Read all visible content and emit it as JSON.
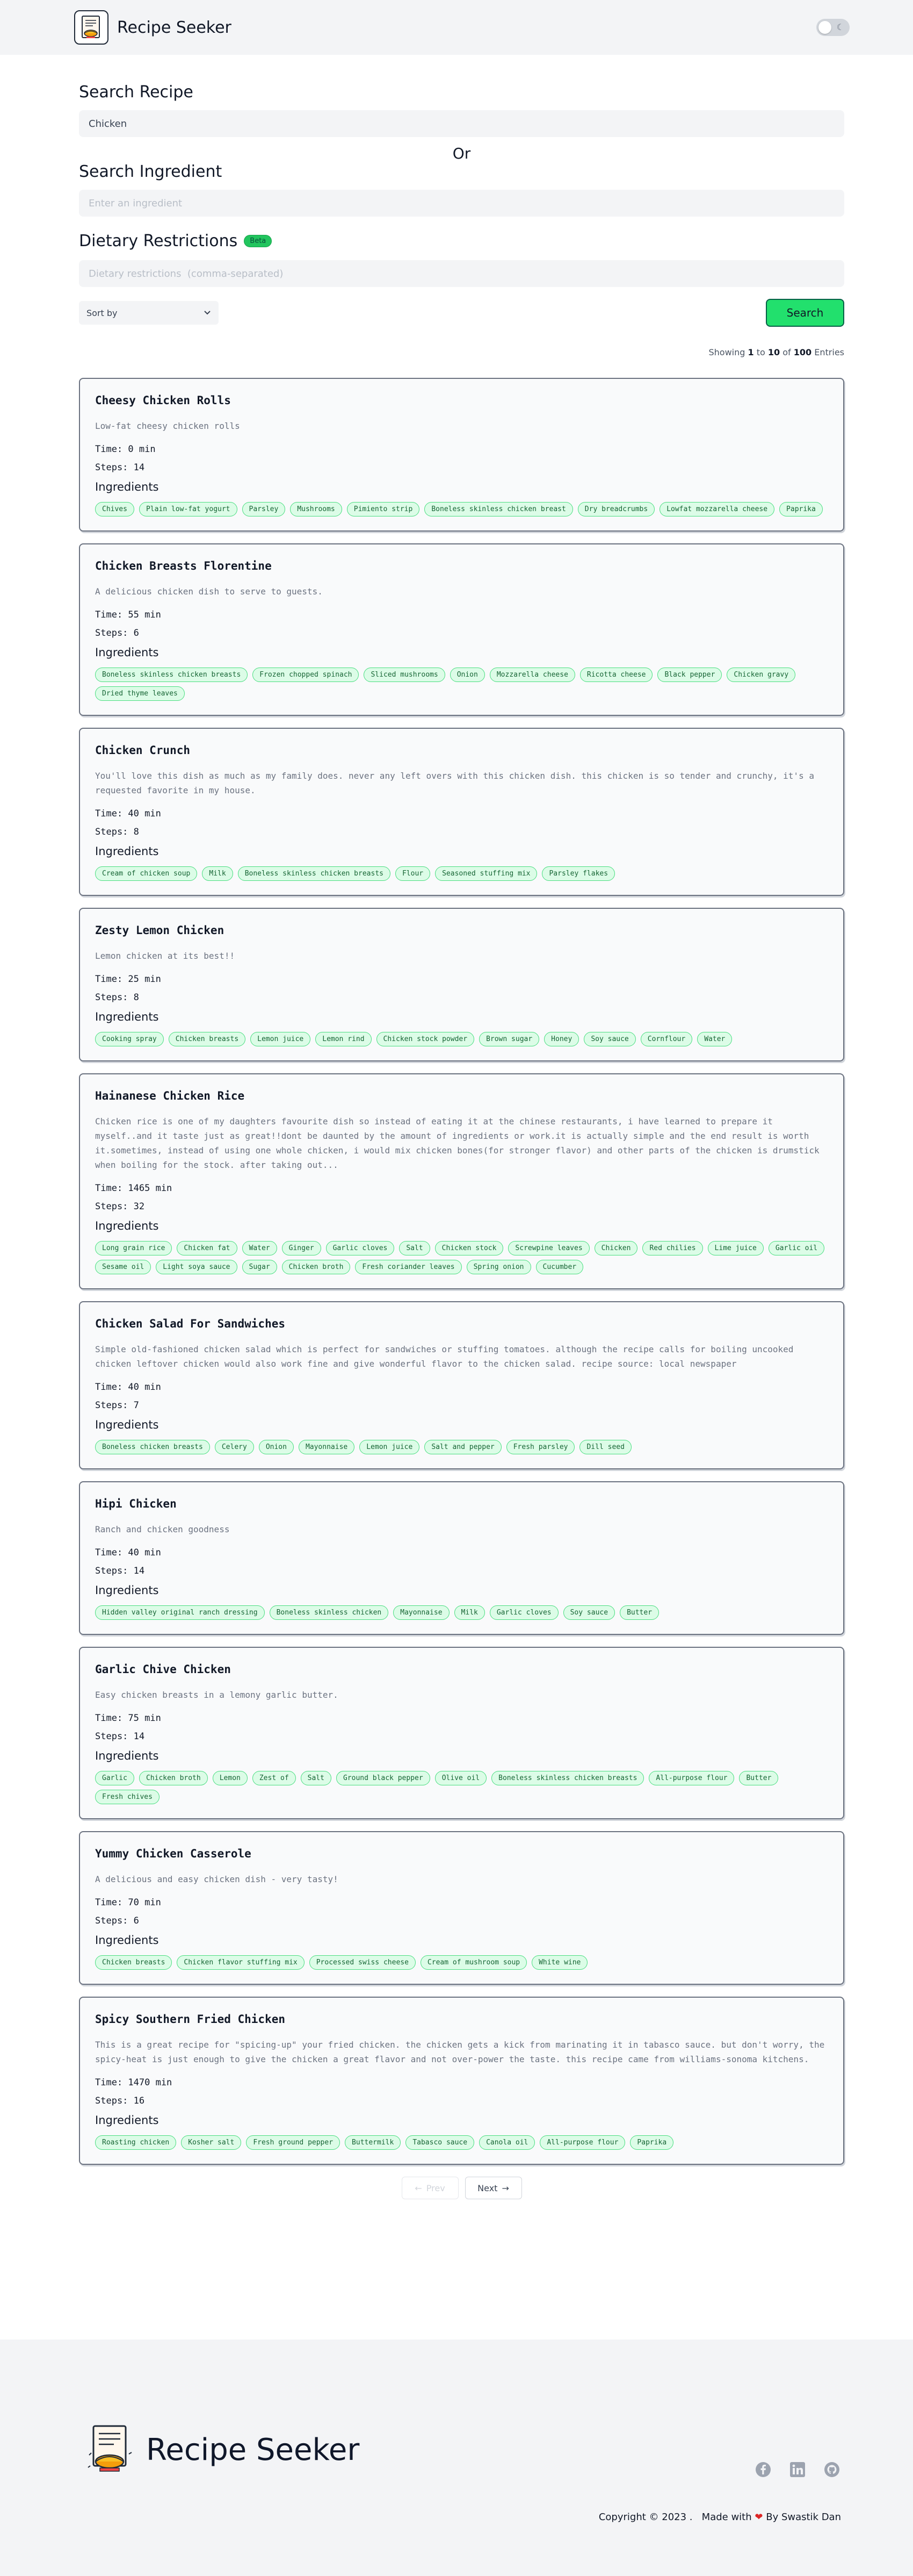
{
  "header": {
    "title": "Recipe Seeker"
  },
  "search": {
    "recipe_label": "Search Recipe",
    "recipe_value": "Chicken",
    "or_label": "Or",
    "ingredient_label": "Search Ingredient",
    "ingredient_placeholder": "Enter an ingredient",
    "dietary_label": "Dietary Restrictions",
    "beta_badge": "Beta",
    "dietary_placeholder": "Dietary restrictions  (comma-separated)",
    "sort_label": "Sort by",
    "search_button": "Search"
  },
  "results": {
    "showing_prefix": "Showing",
    "from": "1",
    "to_word": "to",
    "to": "10",
    "of_word": "of",
    "total": "100",
    "suffix": "Entries"
  },
  "recipes": [
    {
      "title": "Cheesy Chicken Rolls",
      "description": "Low-fat cheesy chicken rolls",
      "time": "Time: 0 min",
      "steps": "Steps: 14",
      "ingredients_label": "Ingredients",
      "ingredients": [
        "Chives",
        "Plain low-fat yogurt",
        "Parsley",
        "Mushrooms",
        "Pimiento strip",
        "Boneless skinless chicken breast",
        "Dry breadcrumbs",
        "Lowfat mozzarella cheese",
        "Paprika"
      ]
    },
    {
      "title": "Chicken Breasts Florentine",
      "description": "A delicious chicken dish to serve to guests.",
      "time": "Time: 55 min",
      "steps": "Steps: 6",
      "ingredients_label": "Ingredients",
      "ingredients": [
        "Boneless skinless chicken breasts",
        "Frozen chopped spinach",
        "Sliced mushrooms",
        "Onion",
        "Mozzarella cheese",
        "Ricotta cheese",
        "Black pepper",
        "Chicken gravy",
        "Dried thyme leaves"
      ]
    },
    {
      "title": "Chicken Crunch",
      "description": "You'll love this dish as much as my family does. never any left overs with this chicken dish. this chicken is so tender and crunchy, it's a requested favorite in my house.",
      "time": "Time: 40 min",
      "steps": "Steps: 8",
      "ingredients_label": "Ingredients",
      "ingredients": [
        "Cream of chicken soup",
        "Milk",
        "Boneless skinless chicken breasts",
        "Flour",
        "Seasoned stuffing mix",
        "Parsley flakes"
      ]
    },
    {
      "title": "Zesty Lemon Chicken",
      "description": "Lemon chicken at its best!!",
      "time": "Time: 25 min",
      "steps": "Steps: 8",
      "ingredients_label": "Ingredients",
      "ingredients": [
        "Cooking spray",
        "Chicken breasts",
        "Lemon juice",
        "Lemon rind",
        "Chicken stock powder",
        "Brown sugar",
        "Honey",
        "Soy sauce",
        "Cornflour",
        "Water"
      ]
    },
    {
      "title": "Hainanese Chicken Rice",
      "description": "Chicken rice is one of my daughters favourite dish so instead of eating it at the chinese restaurants, i have learned to prepare it myself..and it taste just as great!!dont be daunted by the amount of ingredients or work.it is actually simple and the end result is worth it.sometimes, instead of using one whole chicken, i would mix chicken bones(for stronger flavor) and other parts of the chicken is drumstick when boiling for the stock. after taking out...",
      "time": "Time: 1465 min",
      "steps": "Steps: 32",
      "ingredients_label": "Ingredients",
      "ingredients": [
        "Long grain rice",
        "Chicken fat",
        "Water",
        "Ginger",
        "Garlic cloves",
        "Salt",
        "Chicken stock",
        "Screwpine leaves",
        "Chicken",
        "Red chilies",
        "Lime juice",
        "Garlic oil",
        "Sesame oil",
        "Light soya sauce",
        "Sugar",
        "Chicken broth",
        "Fresh coriander leaves",
        "Spring onion",
        "Cucumber"
      ]
    },
    {
      "title": "Chicken Salad For Sandwiches",
      "description": "Simple old-fashioned chicken salad which is perfect for sandwiches or stuffing tomatoes. although the recipe calls for boiling uncooked chicken leftover chicken would also work fine and give wonderful flavor to the chicken salad. recipe source: local newspaper",
      "time": "Time: 40 min",
      "steps": "Steps: 7",
      "ingredients_label": "Ingredients",
      "ingredients": [
        "Boneless chicken breasts",
        "Celery",
        "Onion",
        "Mayonnaise",
        "Lemon juice",
        "Salt and pepper",
        "Fresh parsley",
        "Dill seed"
      ]
    },
    {
      "title": "Hipi Chicken",
      "description": "Ranch and chicken goodness",
      "time": "Time: 40 min",
      "steps": "Steps: 14",
      "ingredients_label": "Ingredients",
      "ingredients": [
        "Hidden valley original ranch dressing",
        "Boneless skinless chicken",
        "Mayonnaise",
        "Milk",
        "Garlic cloves",
        "Soy sauce",
        "Butter"
      ]
    },
    {
      "title": "Garlic Chive Chicken",
      "description": "Easy chicken breasts in a lemony garlic butter.",
      "time": "Time: 75 min",
      "steps": "Steps: 14",
      "ingredients_label": "Ingredients",
      "ingredients": [
        "Garlic",
        "Chicken broth",
        "Lemon",
        "Zest of",
        "Salt",
        "Ground black pepper",
        "Olive oil",
        "Boneless skinless chicken breasts",
        "All-purpose flour",
        "Butter",
        "Fresh chives"
      ]
    },
    {
      "title": "Yummy Chicken Casserole",
      "description": "A delicious and easy chicken dish - very tasty!",
      "time": "Time: 70 min",
      "steps": "Steps: 6",
      "ingredients_label": "Ingredients",
      "ingredients": [
        "Chicken breasts",
        "Chicken flavor stuffing mix",
        "Processed swiss cheese",
        "Cream of mushroom soup",
        "White wine"
      ]
    },
    {
      "title": "Spicy Southern Fried Chicken",
      "description": "This is a great recipe for \"spicing-up\" your fried chicken. the chicken gets a kick from marinating it in tabasco sauce. but don't worry, the spicy-heat is just enough to give the chicken a great flavor and not over-power the taste. this recipe came from williams-sonoma kitchens.",
      "time": "Time: 1470 min",
      "steps": "Steps: 16",
      "ingredients_label": "Ingredients",
      "ingredients": [
        "Roasting chicken",
        "Kosher salt",
        "Fresh ground pepper",
        "Buttermilk",
        "Tabasco sauce",
        "Canola oil",
        "All-purpose flour",
        "Paprika"
      ]
    }
  ],
  "pagination": {
    "prev": "Prev",
    "next": "Next"
  },
  "footer": {
    "title": "Recipe Seeker",
    "copyright": "Copyright © 2023 .",
    "made_with": "Made with",
    "by": "By Swastik Dan",
    "socials": [
      "facebook-icon",
      "linkedin-icon",
      "github-icon"
    ]
  },
  "colors": {
    "accent": "#22e06d",
    "tag_bg": "#dcfce7",
    "tag_border": "#4ade80",
    "heart": "#dc2626"
  }
}
